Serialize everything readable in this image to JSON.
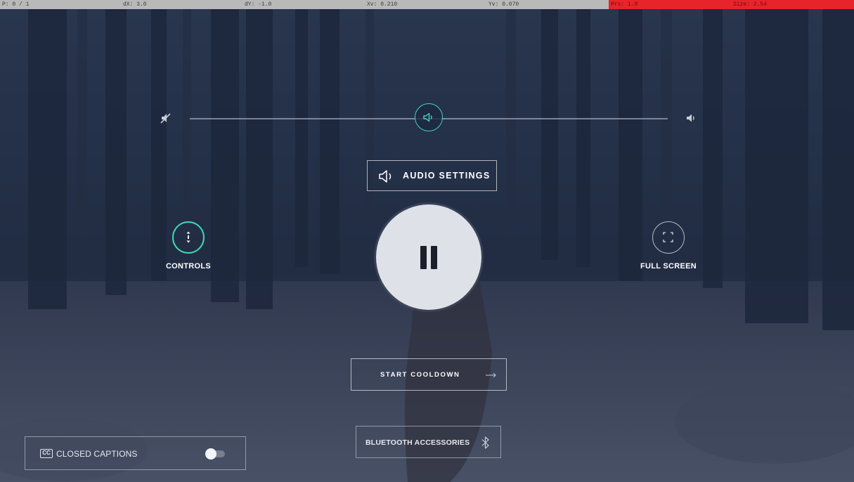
{
  "debug_bar": {
    "p": "P: 0 / 1",
    "dx": "dX: 3.0",
    "dy": "dY: -1.0",
    "xv": "Xv: 0.210",
    "yv": "Yv: 0.070",
    "prs": "Prs: 1.0",
    "size": "Size: 2.54"
  },
  "colors": {
    "accent": "#3dd9b4",
    "overlay": "#1c2642",
    "debug_bar": "#b9b9b9",
    "debug_alert": "#e8242b",
    "pause_button": "#dfe1e8"
  },
  "volume": {
    "level_fraction": 0.5,
    "min_icon": "mute-speaker-icon",
    "max_icon": "speaker-loud-icon",
    "thumb_icon": "speaker-icon"
  },
  "audio_settings": {
    "label": "AUDIO SETTINGS",
    "icon": "speaker-icon"
  },
  "playback": {
    "state_icon": "pause-icon"
  },
  "controls_button": {
    "label": "CONTROLS",
    "icon": "up-down-arrows-icon"
  },
  "fullscreen_button": {
    "label": "FULL SCREEN",
    "icon": "fullscreen-corners-icon"
  },
  "start_cooldown": {
    "label": "START COOLDOWN",
    "icon": "arrow-right-icon"
  },
  "bluetooth": {
    "label": "BLUETOOTH ACCESSORIES",
    "icon": "bluetooth-icon"
  },
  "closed_captions": {
    "label": "CLOSED CAPTIONS",
    "badge": "CC",
    "enabled": false
  }
}
